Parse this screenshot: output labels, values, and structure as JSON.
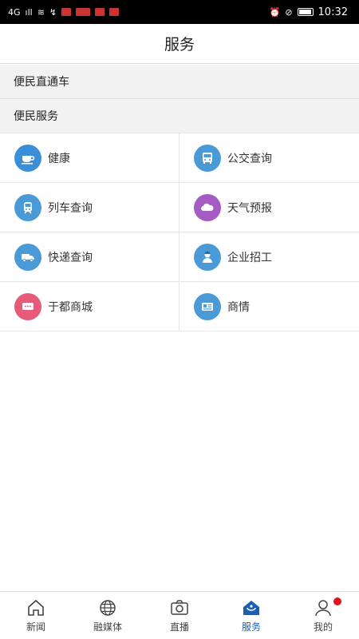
{
  "status_bar": {
    "left_glyphs": [
      "4G",
      "ıll",
      "≋",
      "↯"
    ],
    "right_glyphs": [
      "⏰",
      "⊘"
    ],
    "time": "10:32"
  },
  "header": {
    "title": "服务"
  },
  "sections": [
    {
      "label": "便民直通车"
    },
    {
      "label": "便民服务"
    }
  ],
  "services": [
    {
      "label": "健康",
      "icon": "coffee-cup-icon",
      "color": "#3b8fd9"
    },
    {
      "label": "公交查询",
      "icon": "bus-icon",
      "color": "#4a9ad8"
    },
    {
      "label": "列车查询",
      "icon": "train-icon",
      "color": "#4a9ad8"
    },
    {
      "label": "天气预报",
      "icon": "weather-cloud-icon",
      "color": "#a45cc2"
    },
    {
      "label": "快递查询",
      "icon": "delivery-truck-icon",
      "color": "#4a9ad8"
    },
    {
      "label": "企业招工",
      "icon": "worker-icon",
      "color": "#4a9ad8"
    },
    {
      "label": "于都商城",
      "icon": "shop-chat-icon",
      "color": "#e65a7a"
    },
    {
      "label": "商情",
      "icon": "newspaper-icon",
      "color": "#4a9ad8"
    }
  ],
  "bottom_nav": {
    "items": [
      {
        "label": "新闻",
        "icon": "home-icon"
      },
      {
        "label": "融媒体",
        "icon": "globe-icon"
      },
      {
        "label": "直播",
        "icon": "camera-icon"
      },
      {
        "label": "服务",
        "icon": "service-icon"
      },
      {
        "label": "我的",
        "icon": "user-icon"
      }
    ],
    "active_index": 3,
    "active_color": "#1a5fb4"
  }
}
